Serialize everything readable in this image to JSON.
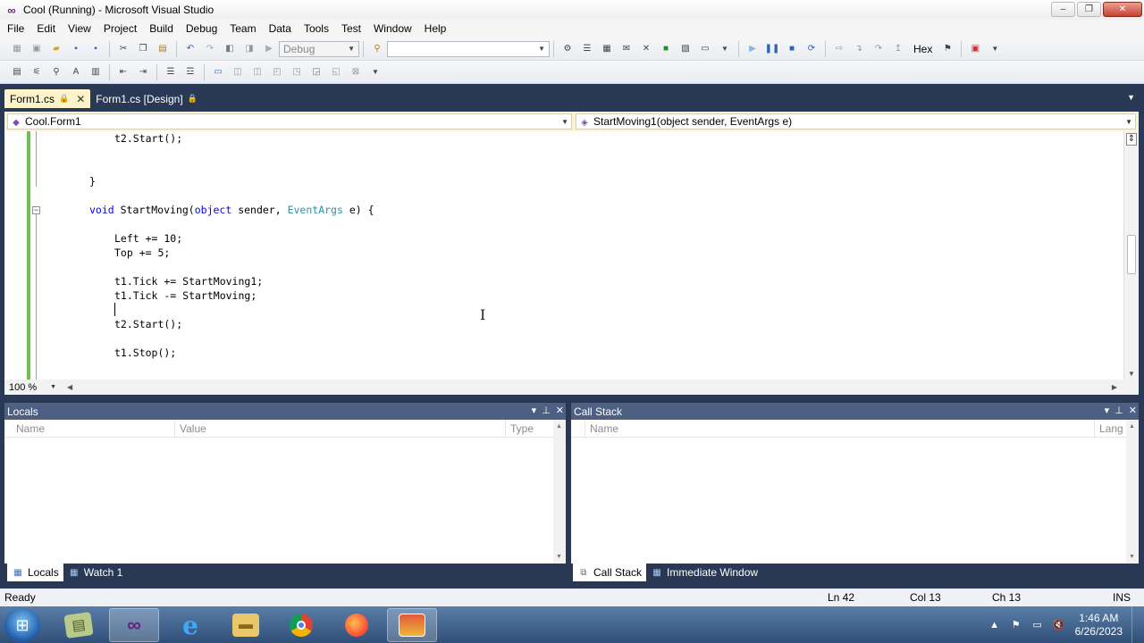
{
  "window": {
    "title": "Cool (Running) - Microsoft Visual Studio",
    "minimize_glyph": "‒",
    "restore_glyph": "❐",
    "close_glyph": "✕"
  },
  "menu": [
    "File",
    "Edit",
    "View",
    "Project",
    "Build",
    "Debug",
    "Team",
    "Data",
    "Tools",
    "Test",
    "Window",
    "Help"
  ],
  "toolbar": {
    "config_value": "Debug",
    "platform_value": "",
    "hex_label": "Hex"
  },
  "tabs": [
    {
      "label": "Form1.cs",
      "active": true
    },
    {
      "label": "Form1.cs [Design]",
      "active": false
    }
  ],
  "navbar": {
    "type_combo": "Cool.Form1",
    "member_combo": "StartMoving1(object sender, EventArgs e)"
  },
  "code": {
    "line1": "t2.Start();",
    "line2": "}",
    "line3_kw": "void",
    "line3_name": " StartMoving(",
    "line3_kw2": "object",
    "line3_mid": " sender, ",
    "line3_type": "EventArgs",
    "line3_end": " e) {",
    "line4": "Left += 10;",
    "line5": "Top += 5;",
    "line6": "t1.Tick += StartMoving1;",
    "line7": "t1.Tick -= StartMoving;",
    "line8": "t2.Start();",
    "line9": "t1.Stop();"
  },
  "zoom": "100 %",
  "locals": {
    "title": "Locals",
    "columns": [
      "Name",
      "Value",
      "Type"
    ],
    "tabs": [
      "Locals",
      "Watch 1"
    ]
  },
  "callstack": {
    "title": "Call Stack",
    "columns": [
      "Name",
      "Lang"
    ],
    "tabs": [
      "Call Stack",
      "Immediate Window"
    ]
  },
  "status": {
    "ready": "Ready",
    "ln": "Ln 42",
    "col": "Col 13",
    "ch": "Ch 13",
    "ins": "INS"
  },
  "taskbar": {
    "time": "1:46 AM",
    "date": "6/26/2023",
    "apps": [
      "notepad-icon",
      "visual-studio-icon",
      "internet-explorer-icon",
      "file-explorer-icon",
      "chrome-icon",
      "firefox-icon",
      "windows-forms-app-icon"
    ]
  },
  "colors": {
    "accent": "#293955",
    "active_tab": "#fff4c9",
    "keyword": "#0000ff",
    "type": "#2b91af"
  }
}
